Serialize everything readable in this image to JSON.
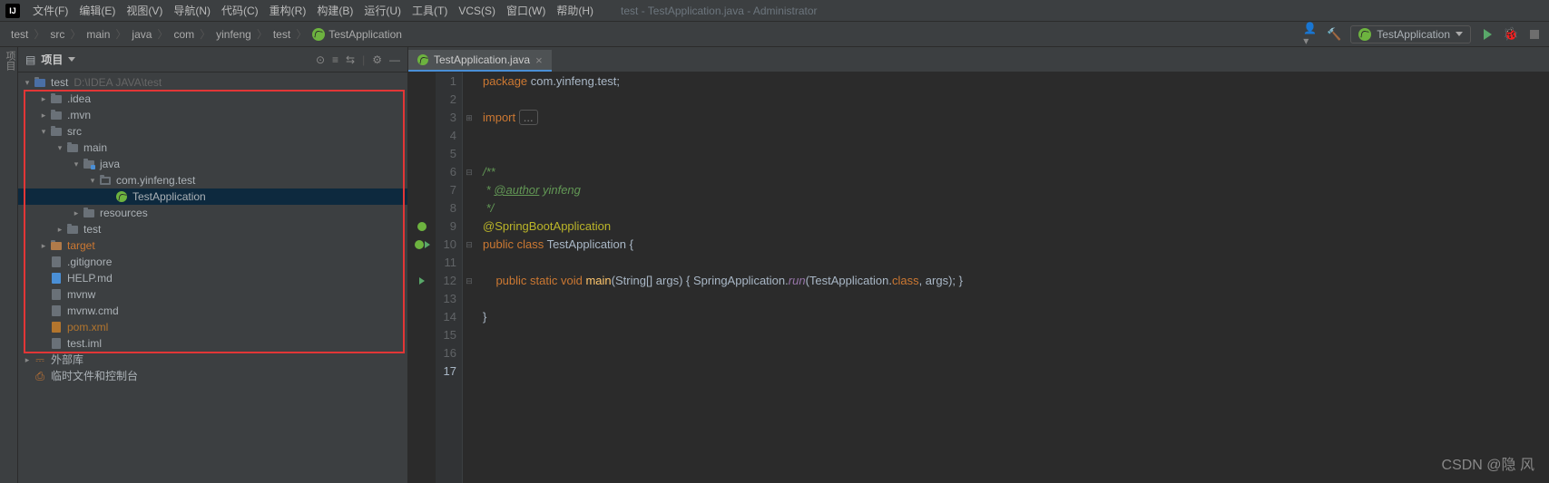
{
  "window": {
    "title": "test - TestApplication.java - Administrator"
  },
  "menu": {
    "file": "文件(F)",
    "edit": "编辑(E)",
    "view": "视图(V)",
    "navigate": "导航(N)",
    "code": "代码(C)",
    "refactor": "重构(R)",
    "build": "构建(B)",
    "run": "运行(U)",
    "tools": "工具(T)",
    "vcs": "VCS(S)",
    "window": "窗口(W)",
    "help": "帮助(H)"
  },
  "breadcrumb": {
    "p0": "test",
    "p1": "src",
    "p2": "main",
    "p3": "java",
    "p4": "com",
    "p5": "yinfeng",
    "p6": "test",
    "p7": "TestApplication"
  },
  "runconfig": {
    "name": "TestApplication"
  },
  "toolwindow": {
    "title": "项目",
    "vertical_tab": "项目"
  },
  "tree": {
    "root": "test",
    "root_hint": "D:\\IDEA JAVA\\test",
    "idea": ".idea",
    "mvn": ".mvn",
    "src": "src",
    "main": "main",
    "java": "java",
    "pkg": "com.yinfeng.test",
    "app": "TestApplication",
    "resources": "resources",
    "test": "test",
    "target": "target",
    "gitignore": ".gitignore",
    "helpmd": "HELP.md",
    "mvnw": "mvnw",
    "mvnwcmd": "mvnw.cmd",
    "pom": "pom.xml",
    "iml": "test.iml",
    "ext_lib": "外部库",
    "scratches": "临时文件和控制台"
  },
  "tab": {
    "file": "TestApplication.java"
  },
  "code": {
    "l1_kw": "package ",
    "l1_txt": "com.yinfeng.test;",
    "l3_kw": "import ",
    "l3_fold": "...",
    "l6": "/**",
    "l7a": " * ",
    "l7b": "@author",
    "l7c": " yinfeng",
    "l8": " */",
    "l9": "@SpringBootApplication",
    "l10_pub": "public ",
    "l10_cls": "class ",
    "l10_name": "TestApplication {",
    "l12_pub": "    public ",
    "l12_static": "static ",
    "l12_void": "void ",
    "l12_main": "main",
    "l12_args": "(String[] args) { SpringApplication.",
    "l12_run": "run",
    "l12_rest1": "(TestApplication.",
    "l12_class": "class",
    "l12_rest2": ", args); }",
    "l14": "}"
  },
  "watermark": "CSDN @隐 风"
}
